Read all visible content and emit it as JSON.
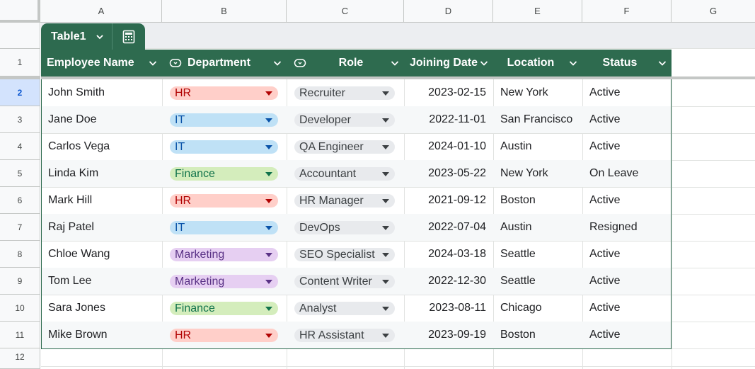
{
  "columns": [
    "A",
    "B",
    "C",
    "D",
    "E",
    "F",
    "G"
  ],
  "rows": [
    "1",
    "2",
    "3",
    "4",
    "5",
    "6",
    "7",
    "8",
    "9",
    "10",
    "11",
    "12"
  ],
  "table": {
    "name": "Table1",
    "headers": {
      "employee_name": "Employee Name",
      "department": "Department",
      "role": "Role",
      "joining_date": "Joining Date",
      "location": "Location",
      "status": "Status"
    },
    "records": [
      {
        "name": "John Smith",
        "department": "HR",
        "role": "Recruiter",
        "date": "2023-02-15",
        "location": "New York",
        "status": "Active"
      },
      {
        "name": "Jane Doe",
        "department": "IT",
        "role": "Developer",
        "date": "2022-11-01",
        "location": "San Francisco",
        "status": "Active"
      },
      {
        "name": "Carlos Vega",
        "department": "IT",
        "role": "QA Engineer",
        "date": "2024-01-10",
        "location": "Austin",
        "status": "Active"
      },
      {
        "name": "Linda Kim",
        "department": "Finance",
        "role": "Accountant",
        "date": "2023-05-22",
        "location": "New York",
        "status": "On Leave"
      },
      {
        "name": "Mark Hill",
        "department": "HR",
        "role": "HR Manager",
        "date": "2021-09-12",
        "location": "Boston",
        "status": "Active"
      },
      {
        "name": "Raj Patel",
        "department": "IT",
        "role": "DevOps",
        "date": "2022-07-04",
        "location": "Austin",
        "status": "Resigned"
      },
      {
        "name": "Chloe Wang",
        "department": "Marketing",
        "role": "SEO Specialist",
        "date": "2024-03-18",
        "location": "Seattle",
        "status": "Active"
      },
      {
        "name": "Tom Lee",
        "department": "Marketing",
        "role": "Content Writer",
        "date": "2022-12-30",
        "location": "Seattle",
        "status": "Active"
      },
      {
        "name": "Sara Jones",
        "department": "Finance",
        "role": "Analyst",
        "date": "2023-08-11",
        "location": "Chicago",
        "status": "Active"
      },
      {
        "name": "Mike Brown",
        "department": "HR",
        "role": "HR Assistant",
        "date": "2023-09-19",
        "location": "Boston",
        "status": "Active"
      }
    ]
  },
  "chip_colors": {
    "HR": {
      "bg": "#ffcfc9",
      "fg": "#b10202"
    },
    "IT": {
      "bg": "#bfe1f6",
      "fg": "#0a53a8"
    },
    "Finance": {
      "bg": "#d4edbc",
      "fg": "#11734b"
    },
    "Marketing": {
      "bg": "#e6cff2",
      "fg": "#5a3286"
    },
    "Role": {
      "bg": "#e8eaed",
      "fg": "#3c4043"
    }
  },
  "colors": {
    "table_header": "#2e6b4f",
    "selected_row_header": "#d3e3fd"
  }
}
